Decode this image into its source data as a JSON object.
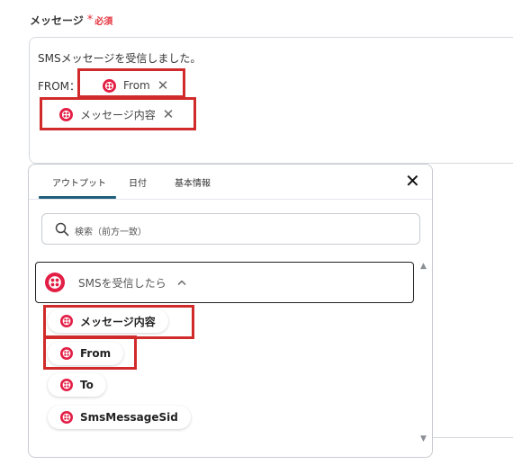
{
  "field": {
    "label": "メッセージ",
    "required_mark": "*",
    "required_text": "必須",
    "line1": "SMSメッセージを受信しました。",
    "line2_prefix": "FROM：",
    "chips": [
      {
        "label": "From",
        "icon": "twilio-icon",
        "remove_icon": "close-icon"
      },
      {
        "label": "メッセージ内容",
        "icon": "twilio-icon",
        "remove_icon": "close-icon"
      }
    ]
  },
  "panel": {
    "tabs": [
      {
        "label": "アウトプット",
        "active": true
      },
      {
        "label": "日付",
        "active": false
      },
      {
        "label": "基本情報",
        "active": false
      }
    ],
    "close_icon": "close-icon",
    "search_placeholder": "検索（前方一致）",
    "group": {
      "label": "SMSを受信したら",
      "expanded": true,
      "icon": "twilio-icon"
    },
    "outputs": [
      {
        "label": "メッセージ内容"
      },
      {
        "label": "From"
      },
      {
        "label": "To"
      },
      {
        "label": "SmsMessageSid"
      }
    ]
  },
  "colors": {
    "brand_red": "#e31e45",
    "highlight_red": "#d12a2a",
    "tab_accent": "#1f5f7a",
    "required": "#e5333e"
  }
}
